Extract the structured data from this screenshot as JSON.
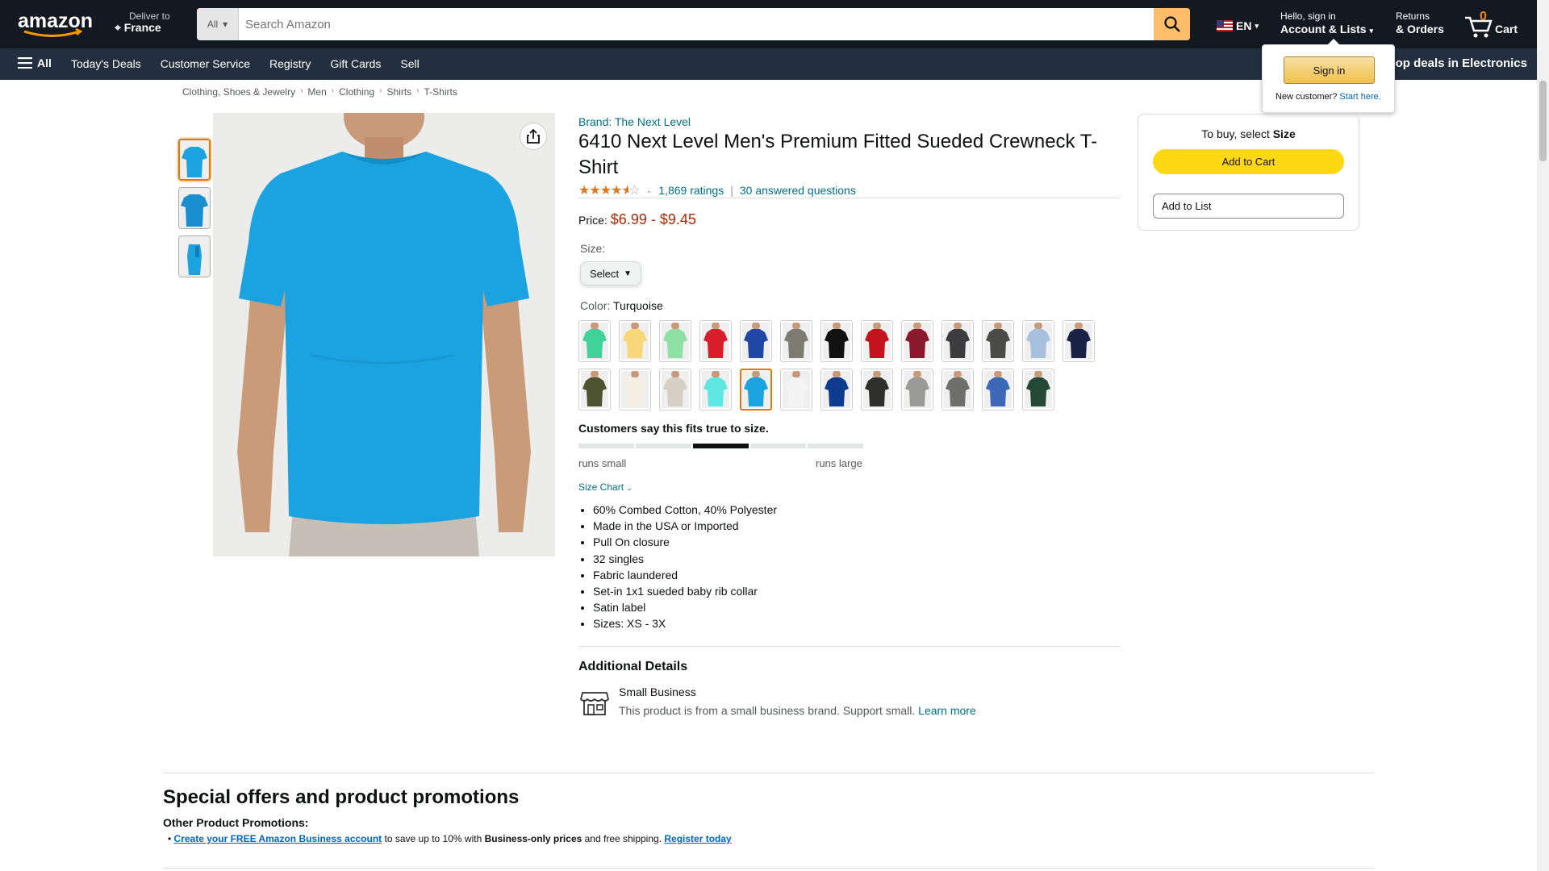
{
  "header": {
    "logo_text": "amazon",
    "deliver_to_label": "Deliver to",
    "deliver_to_location": "France",
    "search_category": "All",
    "search_placeholder": "Search Amazon",
    "language": "EN",
    "account_greeting": "Hello, sign in",
    "account_label": "Account & Lists",
    "returns_line1": "Returns",
    "returns_line2": "& Orders",
    "cart_count": "0",
    "cart_label": "Cart"
  },
  "subnav": {
    "all_label": "All",
    "links": [
      "Today's Deals",
      "Customer Service",
      "Registry",
      "Gift Cards",
      "Sell"
    ],
    "promo": "op deals in Electronics"
  },
  "signin_flyout": {
    "button": "Sign in",
    "new_customer": "New customer?",
    "start_here": "Start here."
  },
  "breadcrumb": [
    "Clothing, Shoes & Jewelry",
    "Men",
    "Clothing",
    "Shirts",
    "T-Shirts"
  ],
  "product": {
    "brand": "Brand: The Next Level",
    "title": "6410 Next Level Men's Premium Fitted Sueded Crewneck T-Shirt",
    "stars": "4.5",
    "ratings": "1,869 ratings",
    "answered": "30 answered questions",
    "price_label": "Price:",
    "price_value": "$6.99 - $9.45",
    "size_label": "Size:",
    "size_select": "Select",
    "color_label": "Color:",
    "color_value": "Turquoise",
    "swatches": [
      "#3fd39a",
      "#f7d77a",
      "#8fe0a5",
      "#d91e2b",
      "#1f47a6",
      "#7d7c70",
      "#111111",
      "#c4121f",
      "#8b1a2e",
      "#3c3c3f",
      "#4a4a48",
      "#a8c0e0",
      "#1a2246",
      "#4d5230",
      "#f4efe2",
      "#d6d0c4",
      "#5ee6e3",
      "#1aa3e0",
      "#f4f4f4",
      "#0d3c8f",
      "#2f302e",
      "#9a9a98",
      "#6e6e6b",
      "#3d68b8",
      "#244a36"
    ],
    "fit_title": "Customers say this fits true to size.",
    "fit_level": 3,
    "runs_small": "runs small",
    "runs_large": "runs large",
    "size_chart": "Size Chart",
    "bullets": [
      "60% Combed Cotton, 40% Polyester",
      "Made in the USA or Imported",
      "Pull On closure",
      "32 singles",
      "Fabric laundered",
      "Set-in 1x1 sueded baby rib collar",
      "Satin label",
      "Sizes: XS - 3X"
    ],
    "additional_title": "Additional Details",
    "small_business_title": "Small Business",
    "small_business_desc": "This product is from a small business brand. Support small.",
    "learn_more": "Learn more"
  },
  "buybox": {
    "to_buy": "To buy, select",
    "to_buy_bold": "Size",
    "add_to_cart": "Add to Cart",
    "add_to_list": "Add to List"
  },
  "promotions": {
    "heading": "Special offers and product promotions",
    "sub": "Other Product Promotions:",
    "link1": "Create your FREE Amazon Business account",
    "text1": " to save up to 10% with ",
    "bold1": "Business-only prices",
    "text2": " and free shipping. ",
    "link2": "Register today"
  },
  "colors": {
    "nav_bg": "#131921",
    "subnav_bg": "#232f3e",
    "accent": "#febd69",
    "link": "#007185",
    "price": "#b12704",
    "product_shirt": "#1aa3e0"
  }
}
